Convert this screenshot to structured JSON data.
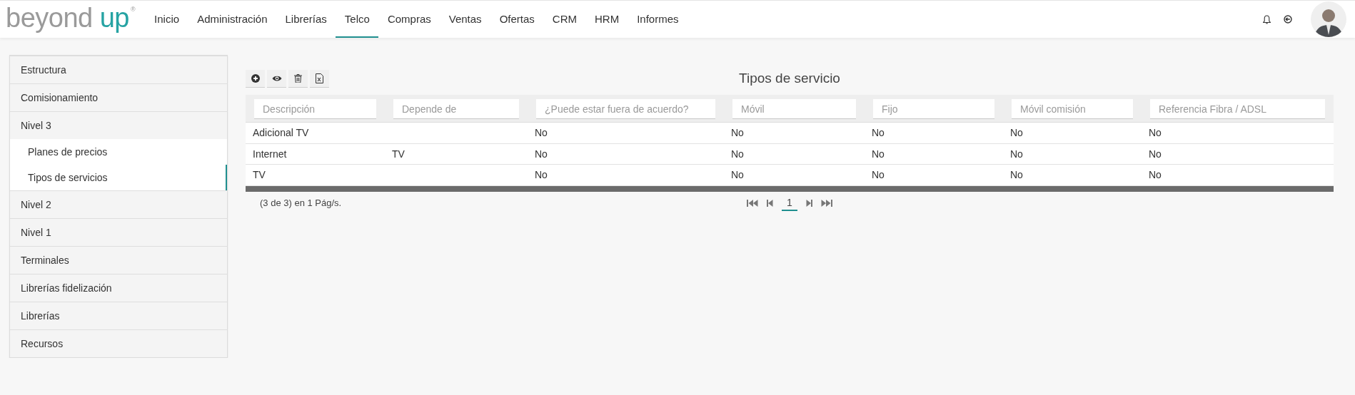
{
  "header": {
    "logo": {
      "word_1": "beyond",
      "word_2": "up",
      "mark": "®"
    },
    "nav": [
      {
        "label": "Inicio",
        "selected": false
      },
      {
        "label": "Administración",
        "selected": false
      },
      {
        "label": "Librerías",
        "selected": false
      },
      {
        "label": "Telco",
        "selected": true
      },
      {
        "label": "Compras",
        "selected": false
      },
      {
        "label": "Ventas",
        "selected": false
      },
      {
        "label": "Ofertas",
        "selected": false
      },
      {
        "label": "CRM",
        "selected": false
      },
      {
        "label": "HRM",
        "selected": false
      },
      {
        "label": "Informes",
        "selected": false
      }
    ]
  },
  "sidebar": {
    "items": [
      {
        "label": "Estructura"
      },
      {
        "label": "Comisionamiento"
      },
      {
        "label": "Nivel 3",
        "children": [
          {
            "label": "Planes de precios",
            "selected": false
          },
          {
            "label": "Tipos de servicios",
            "selected": true
          }
        ]
      },
      {
        "label": "Nivel 2"
      },
      {
        "label": "Nivel 1"
      },
      {
        "label": "Terminales"
      },
      {
        "label": "Librerías fidelización"
      },
      {
        "label": "Librerías"
      },
      {
        "label": "Recursos"
      }
    ]
  },
  "toolbar": [
    {
      "kind": "add"
    },
    {
      "kind": "view"
    },
    {
      "kind": "delete"
    },
    {
      "kind": "excel"
    }
  ],
  "title": "Tipos de servicio",
  "table": {
    "filters": [
      {
        "placeholder": "Descripción"
      },
      {
        "placeholder": "Depende de"
      },
      {
        "placeholder": "¿Puede estar fuera de acuerdo?"
      },
      {
        "placeholder": "Móvil"
      },
      {
        "placeholder": "Fijo"
      },
      {
        "placeholder": "Móvil comisión"
      },
      {
        "placeholder": "Referencia Fibra / ADSL"
      }
    ],
    "rows": [
      {
        "descripcion": "Adicional TV",
        "fuera_de_acuerdo": "No",
        "movil": "No",
        "fijo": "No",
        "movil_comision": "No",
        "referencia_fibra_adsl": "No"
      },
      {
        "descripcion": "Internet",
        "depende_de": "TV",
        "fuera_de_acuerdo": "No",
        "movil": "No",
        "fijo": "No",
        "movil_comision": "No",
        "referencia_fibra_adsl": "No"
      },
      {
        "descripcion": "TV",
        "fuera_de_acuerdo": "No",
        "movil": "No",
        "fijo": "No",
        "movil_comision": "No",
        "referencia_fibra_adsl": "No"
      }
    ]
  },
  "pagination": {
    "summary": "(3 de 3) en 1 Pág/s.",
    "controls": [
      {
        "kind": "first"
      },
      {
        "kind": "prev"
      },
      {
        "kind": "page",
        "label": "1",
        "selected": true
      },
      {
        "kind": "next"
      },
      {
        "kind": "last"
      }
    ]
  }
}
